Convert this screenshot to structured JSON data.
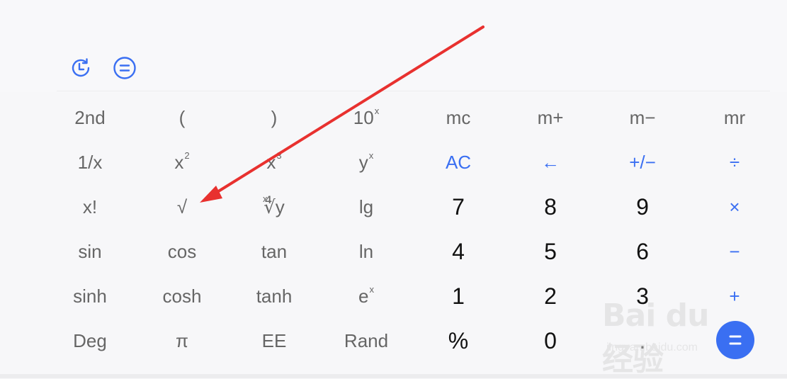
{
  "toolbar": {
    "icons": [
      "history-icon",
      "menu-icon"
    ],
    "accent": "#3a6ff2"
  },
  "keys": [
    [
      "2nd",
      "(",
      ")",
      "10",
      "mc",
      "m+",
      "m−",
      "mr"
    ],
    [
      "1/x",
      "x",
      "x",
      "y",
      "AC",
      "←",
      "+/−",
      "÷"
    ],
    [
      "x!",
      "√",
      "∜y",
      "lg",
      "7",
      "8",
      "9",
      "×"
    ],
    [
      "sin",
      "cos",
      "tan",
      "ln",
      "4",
      "5",
      "6",
      "−"
    ],
    [
      "sinh",
      "cosh",
      "tanh",
      "e",
      "1",
      "2",
      "3",
      "+"
    ],
    [
      "Deg",
      "π",
      "EE",
      "Rand",
      "%",
      "0",
      ".",
      ""
    ]
  ],
  "superscripts": {
    "ten_pow": "x",
    "x_squared": "2",
    "x_cubed": "3",
    "y_pow": "x",
    "e_pow": "x",
    "root_index": "x"
  },
  "fab": {
    "icon": "equals-icon"
  },
  "watermark": {
    "logo": "Bai du 经验",
    "sub": "jingyan.baidu.com"
  },
  "annotation": {
    "type": "red-arrow",
    "color": "#e8312f",
    "points_to": "√"
  }
}
